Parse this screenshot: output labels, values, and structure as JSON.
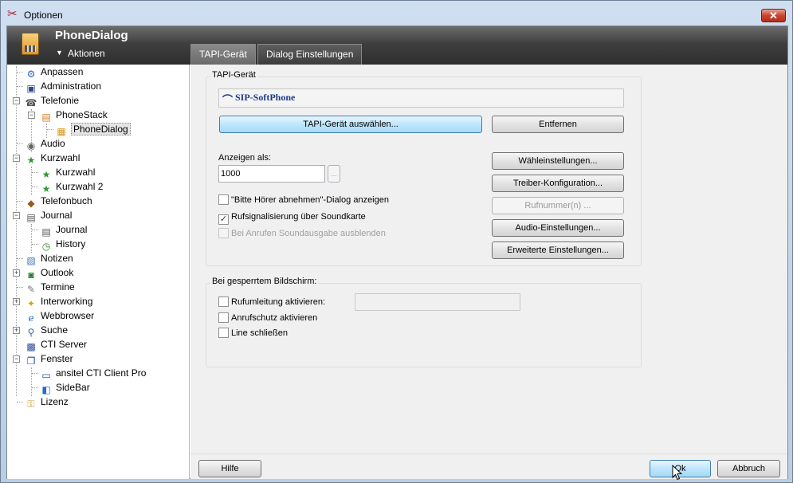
{
  "window": {
    "title": "Optionen",
    "close_symbol": "✕"
  },
  "header": {
    "app_name": "PhoneDialog",
    "actions_label": "Aktionen"
  },
  "tabs": [
    {
      "label": "TAPI-Gerät"
    },
    {
      "label": "Dialog Einstellungen"
    }
  ],
  "tree": [
    {
      "label": "Anpassen",
      "icon": "gear-icon"
    },
    {
      "label": "Administration",
      "icon": "admin-icon"
    },
    {
      "label": "Telefonie",
      "icon": "telephony-icon"
    },
    {
      "label": "PhoneStack",
      "icon": "phonestack-icon"
    },
    {
      "label": "PhoneDialog",
      "icon": "phonedialog-icon"
    },
    {
      "label": "Audio",
      "icon": "speaker-icon"
    },
    {
      "label": "Kurzwahl",
      "icon": "star-icon"
    },
    {
      "label": "Kurzwahl",
      "icon": "star-icon"
    },
    {
      "label": "Kurzwahl 2",
      "icon": "star-icon"
    },
    {
      "label": "Telefonbuch",
      "icon": "book-icon"
    },
    {
      "label": "Journal",
      "icon": "journal-icon"
    },
    {
      "label": "Journal",
      "icon": "journal-icon"
    },
    {
      "label": "History",
      "icon": "history-icon"
    },
    {
      "label": "Notizen",
      "icon": "notes-icon"
    },
    {
      "label": "Outlook",
      "icon": "outlook-icon"
    },
    {
      "label": "Termine",
      "icon": "calendar-icon"
    },
    {
      "label": "Interworking",
      "icon": "interworking-icon"
    },
    {
      "label": "Webbrowser",
      "icon": "browser-icon"
    },
    {
      "label": "Suche",
      "icon": "search-icon"
    },
    {
      "label": "CTI Server",
      "icon": "server-icon"
    },
    {
      "label": "Fenster",
      "icon": "windows-icon"
    },
    {
      "label": "ansitel CTI Client Pro",
      "icon": "window-icon"
    },
    {
      "label": "SideBar",
      "icon": "sidebar-icon"
    },
    {
      "label": "Lizenz",
      "icon": "license-icon"
    }
  ],
  "tapi": {
    "group_label": "TAPI-Gerät",
    "device_name": "SIP-SoftPhone",
    "select_button": "TAPI-Gerät auswählen...",
    "remove_button": "Entfernen",
    "display_as_label": "Anzeigen als:",
    "display_as_value": "1000",
    "browse_button": "...",
    "checkboxes": [
      {
        "label": "\"Bitte Hörer abnehmen\"-Dialog anzeigen",
        "checked": false
      },
      {
        "label": "Rufsignalisierung über Soundkarte",
        "checked": true
      },
      {
        "label": "Bei Anrufen Soundausgabe ausblenden",
        "checked": false
      }
    ],
    "buttons": [
      {
        "label": "Wähleinstellungen..."
      },
      {
        "label": "Treiber-Konfiguration..."
      },
      {
        "label": "Rufnummer(n) ..."
      },
      {
        "label": "Audio-Einstellungen..."
      },
      {
        "label": "Erweiterte Einstellungen..."
      }
    ]
  },
  "locked": {
    "group_label": "Bei gesperrtem Bildschirm:",
    "checkboxes": [
      {
        "label": "Rufumleitung aktivieren:",
        "checked": false
      },
      {
        "label": "Anrufschutz aktivieren",
        "checked": false
      },
      {
        "label": "Line schließen",
        "checked": false
      }
    ],
    "forward_value": ""
  },
  "footer": {
    "help_button": "Hilfe",
    "ok_button": "Ok",
    "cancel_button": "Abbruch"
  },
  "colors": {
    "header_dark": "#3f3f3f",
    "focus_blue": "#bee6fd",
    "title_bg": "#cfdff0"
  }
}
